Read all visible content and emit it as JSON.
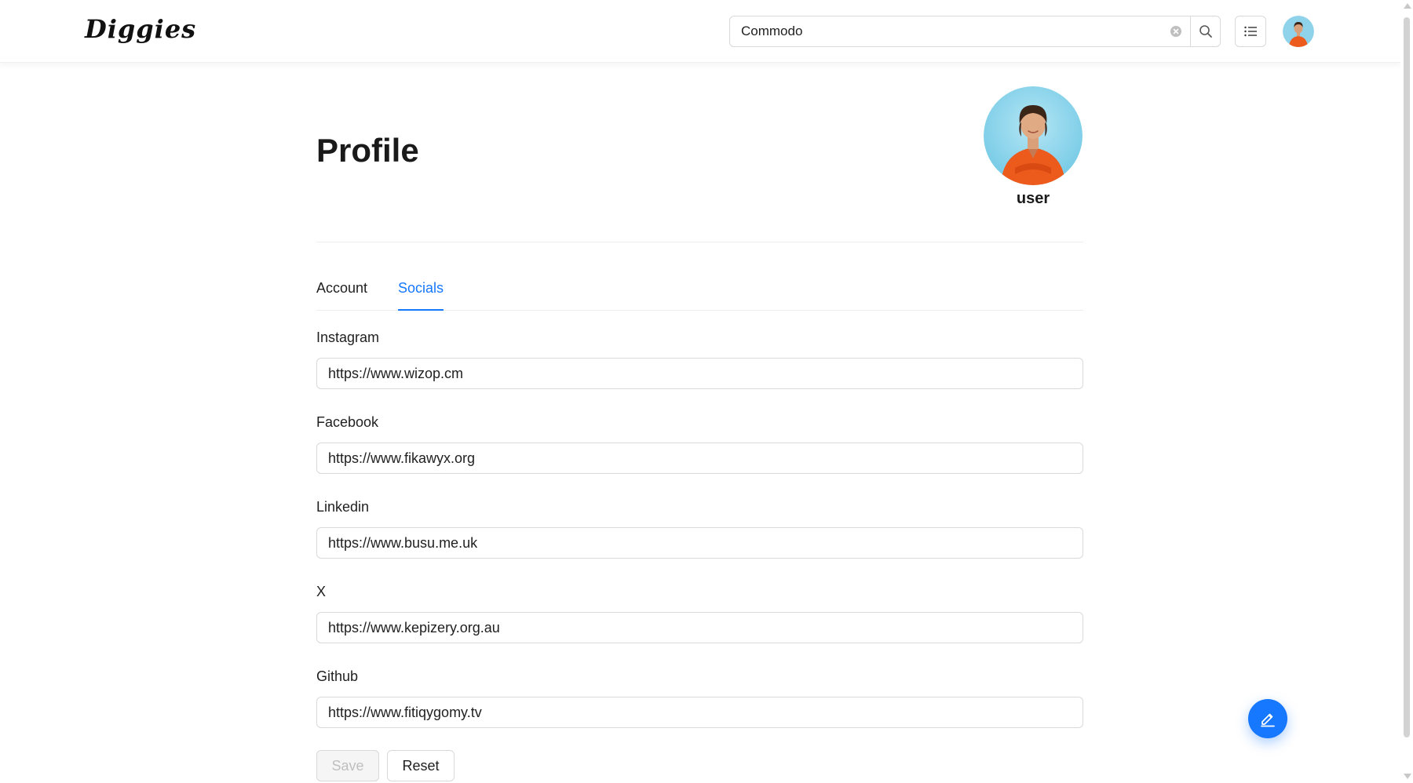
{
  "header": {
    "logo": "Diggies",
    "search": {
      "value": "Commodo",
      "placeholder": ""
    },
    "icons": {
      "clear": "clear-circle-icon",
      "search": "search-icon",
      "menu": "list-icon",
      "avatar": "user-avatar"
    }
  },
  "profile": {
    "title": "Profile",
    "username": "user"
  },
  "tabs": [
    {
      "label": "Account",
      "active": false
    },
    {
      "label": "Socials",
      "active": true
    }
  ],
  "socials": {
    "fields": [
      {
        "label": "Instagram",
        "value": "https://www.wizop.cm"
      },
      {
        "label": "Facebook",
        "value": "https://www.fikawyx.org"
      },
      {
        "label": "Linkedin",
        "value": "https://www.busu.me.uk"
      },
      {
        "label": "X",
        "value": "https://www.kepizery.org.au"
      },
      {
        "label": "Github",
        "value": "https://www.fitiqygomy.tv"
      }
    ]
  },
  "actions": {
    "save_label": "Save",
    "reset_label": "Reset",
    "fab_icon": "edit-icon"
  },
  "colors": {
    "accent": "#1677ff",
    "border": "#d9d9d9",
    "text": "#1f1f1f"
  }
}
